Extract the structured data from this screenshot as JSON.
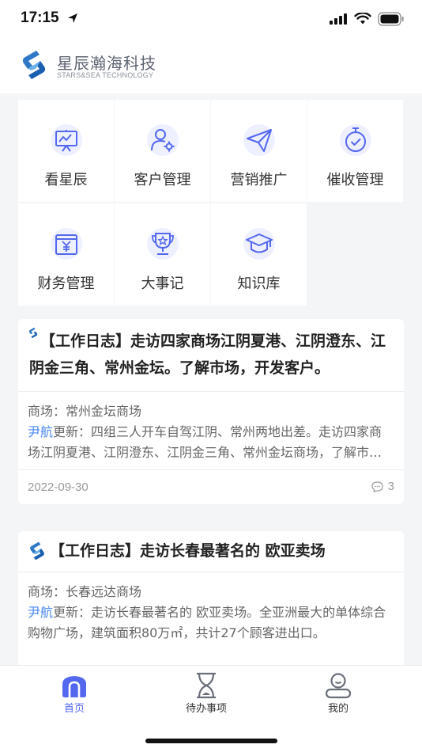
{
  "status_bar": {
    "time": "17:15"
  },
  "header": {
    "title": "星辰瀚海科技",
    "subtitle": "STARS&SEA TECHNOLOGY"
  },
  "menu": [
    {
      "label": "看星辰",
      "icon": "presentation-chart-icon"
    },
    {
      "label": "客户管理",
      "icon": "user-gear-icon"
    },
    {
      "label": "营销推广",
      "icon": "paper-plane-icon"
    },
    {
      "label": "催收管理",
      "icon": "stopwatch-check-icon"
    },
    {
      "label": "财务管理",
      "icon": "yen-document-icon"
    },
    {
      "label": "大事记",
      "icon": "trophy-icon"
    },
    {
      "label": "知识库",
      "icon": "graduation-cap-icon"
    }
  ],
  "posts": [
    {
      "title": "【工作日志】走访四家商场江阴夏港、江阴澄东、江阴金三角、常州金坛。了解市场，开发客户。",
      "mall_line": "商场：常州金坛商场",
      "author": "尹航",
      "update_prefix": "更新：",
      "update_text": "四组三人开车自驾江阴、常州两地出差。走访四家商场江阴夏港、江阴澄东、江阴金三角、常州金坛商场，了解市场，开发客户。",
      "date": "2022-09-30",
      "comments": "3"
    },
    {
      "title": "【工作日志】走访长春最著名的 欧亚卖场",
      "mall_line": "商场：长春远达商场",
      "author": "尹航",
      "update_prefix": "更新：",
      "update_text": "走访长春最著名的 欧亚卖场。全亚洲最大的单体综合购物广场，建筑面积80万㎡，共计27个顾客进出口。"
    }
  ],
  "tabs": [
    {
      "label": "首页",
      "icon": "home-icon",
      "active": true
    },
    {
      "label": "待办事项",
      "icon": "hourglass-icon",
      "active": false
    },
    {
      "label": "我的",
      "icon": "profile-icon",
      "active": false
    }
  ],
  "colors": {
    "accent": "#5468ef",
    "author_link": "#4a88f0",
    "logo_blue": "#2f78c8"
  }
}
